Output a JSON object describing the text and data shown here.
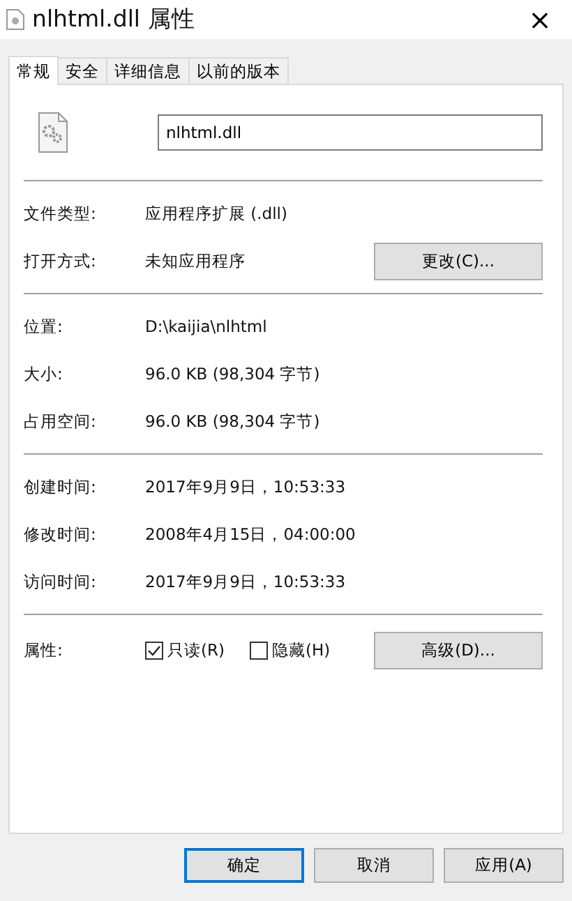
{
  "window": {
    "title": "nlhtml.dll 属性",
    "close": "×"
  },
  "tabs": [
    {
      "label": "常规",
      "selected": true
    },
    {
      "label": "安全",
      "selected": false
    },
    {
      "label": "详细信息",
      "selected": false
    },
    {
      "label": "以前的版本",
      "selected": false
    }
  ],
  "file_name": {
    "value": "nlhtml.dll"
  },
  "sections": [
    {
      "rows": [
        {
          "label": "文件类型:",
          "value": "应用程序扩展 (.dll)"
        },
        {
          "label": "打开方式:",
          "value": "未知应用程序",
          "button": "更改(C)..."
        }
      ]
    },
    {
      "rows": [
        {
          "label": "位置:",
          "value": "D:\\kaijia\\nlhtml"
        },
        {
          "label": "大小:",
          "value": "96.0 KB (98,304 字节)"
        },
        {
          "label": "占用空间:",
          "value": "96.0 KB (98,304 字节)"
        }
      ]
    },
    {
      "rows": [
        {
          "label": "创建时间:",
          "value": "2017年9月9日，10:53:33"
        },
        {
          "label": "修改时间:",
          "value": "2008年4月15日，04:00:00"
        },
        {
          "label": "访问时间:",
          "value": "2017年9月9日，10:53:33"
        }
      ]
    }
  ],
  "attributes": {
    "label": "属性:",
    "checkboxes": [
      {
        "label": "只读(R)",
        "checked": true
      },
      {
        "label": "隐藏(H)",
        "checked": false
      }
    ],
    "button": "高级(D)..."
  },
  "buttons": [
    {
      "label": "确定",
      "selected": true
    },
    {
      "label": "取消",
      "selected": false
    },
    {
      "label": "应用(A)",
      "selected": false
    }
  ]
}
